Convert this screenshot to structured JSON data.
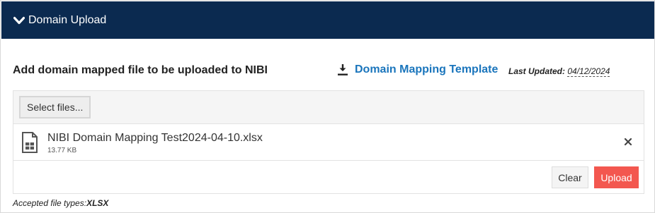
{
  "panel": {
    "title": "Domain Upload",
    "chevron_icon": "chevron-down-icon",
    "header_color": "#0b2a50"
  },
  "content": {
    "heading": "Add domain mapped file to be uploaded to NIBI",
    "template_link": "Domain Mapping Template",
    "template_icon": "download-icon",
    "last_updated_label": "Last Updated:",
    "last_updated_date": "04/12/2024",
    "link_color": "#1a75bc"
  },
  "uploader": {
    "select_label": "Select files...",
    "file": {
      "name": "NIBI Domain Mapping Test2024-04-10.xlsx",
      "size": "13.77 KB",
      "icon": "spreadsheet-file-icon"
    },
    "remove_icon": "close-icon",
    "clear_label": "Clear",
    "upload_label": "Upload",
    "upload_color": "#f3574f"
  },
  "footer": {
    "accepted_label": "Accepted file types:",
    "accepted_types": "XLSX"
  }
}
